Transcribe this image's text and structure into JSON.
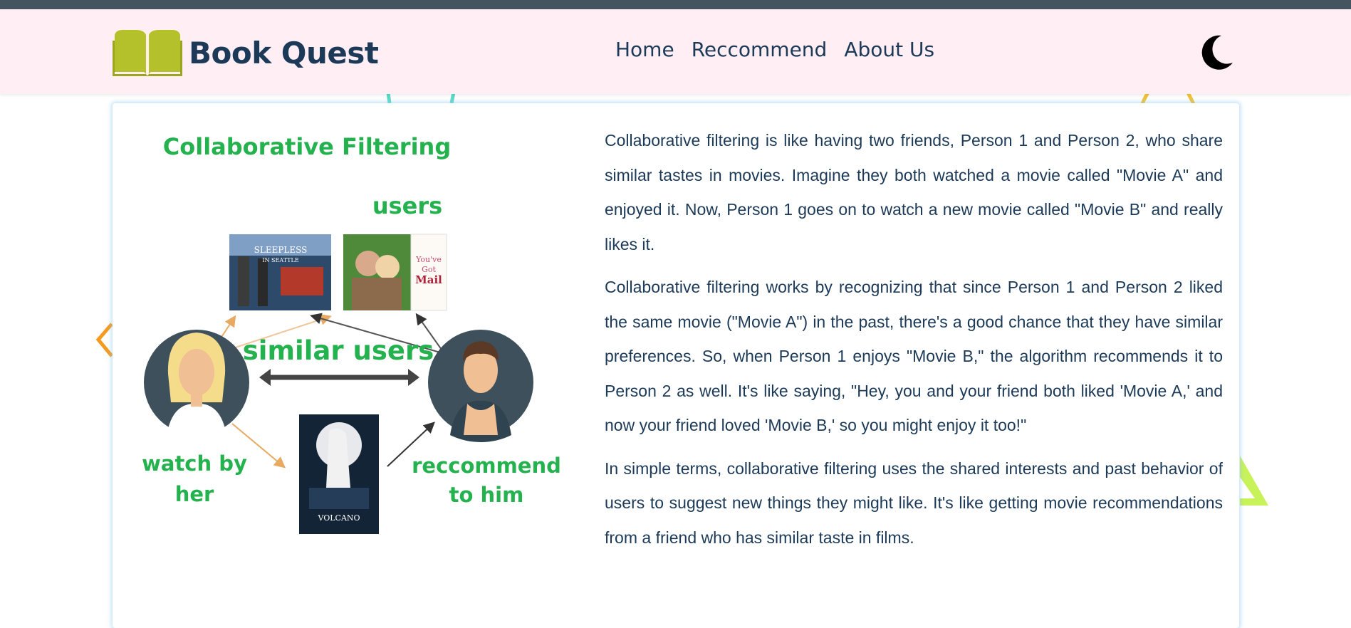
{
  "app": {
    "name": "Book Quest",
    "logo_icon": "open-book-icon",
    "theme_icon": "moon-icon"
  },
  "nav": {
    "links": [
      "Home",
      "Reccommend",
      "About Us"
    ]
  },
  "figure": {
    "title": "Collaborative Filtering",
    "users_label": "users",
    "similar_label": "similar users",
    "left_caption_line1": "watch by",
    "left_caption_line2": "her",
    "right_caption_line1": "reccommend",
    "right_caption_line2": "to him",
    "poster1_line1": "SLEEPLESS",
    "poster1_line2": "IN SEATTLE",
    "poster2_line1": "You've",
    "poster2_line2": "Got",
    "poster2_line3": "Mail",
    "poster3_title": "VOLCANO"
  },
  "description": {
    "paragraphs": [
      "Collaborative filtering is like having two friends, Person 1 and Person 2, who share similar tastes in movies. Imagine they both watched a movie called \"Movie A\" and enjoyed it. Now, Person 1 goes on to watch a new movie called \"Movie B\" and really likes it.",
      "Collaborative filtering works by recognizing that since Person 1 and Person 2 liked the same movie (\"Movie A\") in the past, there's a good chance that they have similar preferences. So, when Person 1 enjoys \"Movie B,\" the algorithm recommends it to Person 2 as well. It's like saying, \"Hey, you and your friend both liked 'Movie A,' and now your friend loved 'Movie B,' so you might enjoy it too!\"",
      "In simple terms, collaborative filtering uses the shared interests and past behavior of users to suggest new things they might like. It's like getting movie recommendations from a friend who has similar taste in films."
    ]
  },
  "colors": {
    "navbar_bg": "#ffeef3",
    "brand_text": "#1c3a57",
    "logo": "#b5c12a",
    "figure_green": "#24b24e",
    "top_strip": "#455560"
  }
}
